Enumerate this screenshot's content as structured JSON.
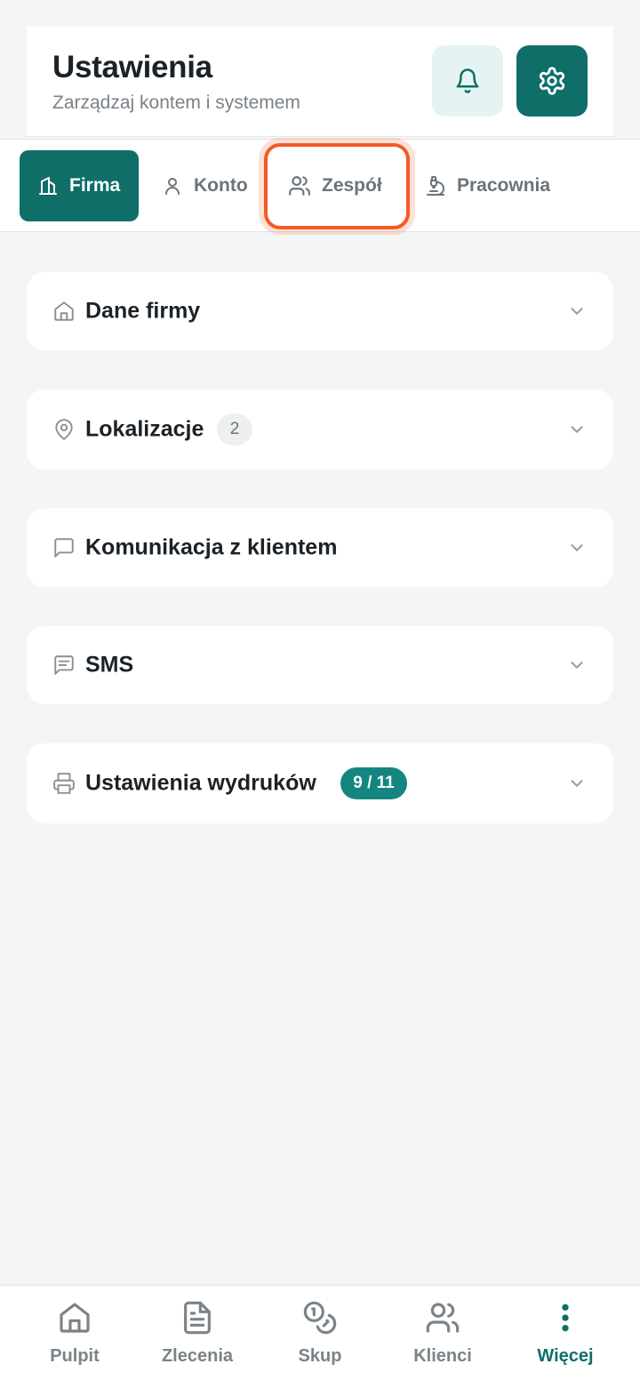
{
  "header": {
    "title": "Ustawienia",
    "subtitle": "Zarządzaj kontem i systemem",
    "bell_icon": "bell-icon",
    "gear_icon": "gear-icon"
  },
  "tabs": [
    {
      "label": "Firma",
      "icon": "building-icon",
      "active": true
    },
    {
      "label": "Konto",
      "icon": "user-icon",
      "active": false
    },
    {
      "label": "Zespół",
      "icon": "users-icon",
      "active": false
    },
    {
      "label": "Pracownia",
      "icon": "microscope-icon",
      "active": false
    }
  ],
  "sections": [
    {
      "title": "Dane firmy",
      "icon": "home-icon"
    },
    {
      "title": "Lokalizacje",
      "icon": "map-pin-icon",
      "badge": "2"
    },
    {
      "title": "Komunikacja z klientem",
      "icon": "message-icon"
    },
    {
      "title": "SMS",
      "icon": "message-text-icon"
    },
    {
      "title": "Ustawienia wydruków",
      "icon": "printer-icon",
      "badge": "9 / 11"
    }
  ],
  "bottom_nav": [
    {
      "label": "Pulpit",
      "icon": "home-icon",
      "active": false
    },
    {
      "label": "Zlecenia",
      "icon": "document-icon",
      "active": false
    },
    {
      "label": "Skup",
      "icon": "coins-icon",
      "active": false
    },
    {
      "label": "Klienci",
      "icon": "users-icon",
      "active": false
    },
    {
      "label": "Więcej",
      "icon": "more-vertical-icon",
      "active": true
    }
  ],
  "colors": {
    "primary": "#0f6e68",
    "badge": "#14867f",
    "highlight": "#f35b24",
    "background": "#f4f6f5"
  }
}
